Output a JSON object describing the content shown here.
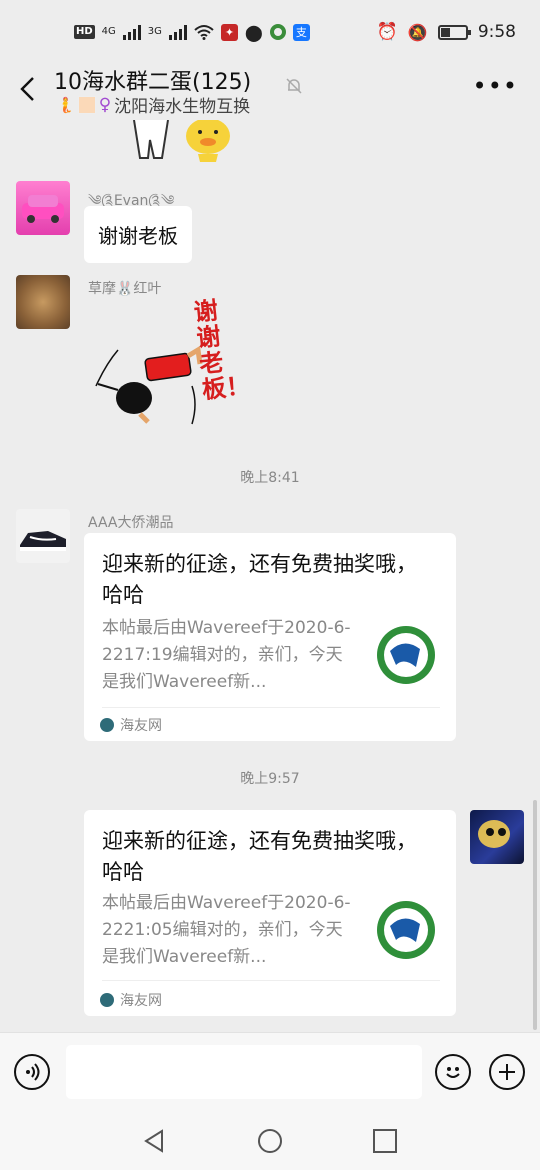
{
  "status_bar": {
    "network_hd": "HD",
    "net1": "4G",
    "net2": "3G",
    "time": "9:58",
    "battery_level": 0.35
  },
  "chat": {
    "title": "10海水群二蛋(125)",
    "subtitle": "沈阳海水生物互换"
  },
  "messages": [
    {
      "sender": "༄༊Evan༊༄",
      "text": "谢谢老板"
    },
    {
      "sender": "草摩🐰红叶",
      "sticker_text": "谢谢老板！"
    },
    {
      "time": "晚上8:41"
    },
    {
      "sender": "AAA大侨潮品",
      "card": {
        "title": "迎来新的征途，还有免费抽奖哦，哈哈",
        "desc": "本帖最后由Wavereef于2020-6-2217:19编辑对的，亲们，今天是我们Wavereef新...",
        "source": "海友网"
      }
    },
    {
      "time": "晚上9:57"
    },
    {
      "sender": "",
      "card": {
        "title": "迎来新的征途，还有免费抽奖哦，哈哈",
        "desc": "本帖最后由Wavereef于2020-6-2221:05编辑对的，亲们，今天是我们Wavereef新...",
        "source": "海友网"
      }
    }
  ],
  "colors": {
    "background": "#ededed",
    "bubble": "#ffffff",
    "meta_text": "#888888"
  }
}
